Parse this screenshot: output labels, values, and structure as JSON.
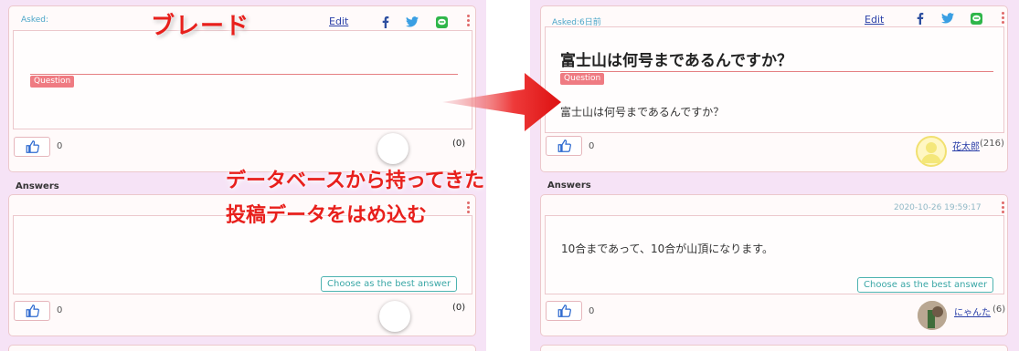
{
  "left": {
    "asked_label": "Asked:",
    "edit": "Edit",
    "question_badge": "Question",
    "like_count": "0",
    "answer_count_paren": "(0)",
    "answers_label": "Answers",
    "best_answer_button": "Choose as the best answer",
    "answer_like_count": "0",
    "answer_count_paren2": "(0)"
  },
  "right": {
    "asked_label": "Asked:6日前",
    "edit": "Edit",
    "question_title": "富士山は何号まであるんですか？",
    "question_badge": "Question",
    "question_body": "富士山は何号まであるんですか？",
    "like_count": "0",
    "asker_name": "花太郎",
    "asker_score": "(216)",
    "answers_label": "Answers",
    "answer_date": "2020-10-26 19:59:17",
    "answer_body": "10合まであって、10合が山頂になります。",
    "best_answer_button": "Choose as the best answer",
    "answer_like_count": "0",
    "answerer_name": "にゃんた",
    "answerer_score": "(6)"
  },
  "overlay": {
    "blade_label": "ブレード",
    "caption_line1": "データベースから持ってきた",
    "caption_line2": "投稿データをはめ込む"
  },
  "icons": [
    "facebook-icon",
    "twitter-icon",
    "line-icon",
    "kebab-menu-icon",
    "thumbs-up-icon",
    "arrow-icon"
  ],
  "colors": {
    "panel_bg": "#f6e3f6",
    "accent_red": "#e8201c",
    "badge_pink": "#ef7b82",
    "teal": "#3aa7a6",
    "link_blue": "#2a3fa8"
  }
}
